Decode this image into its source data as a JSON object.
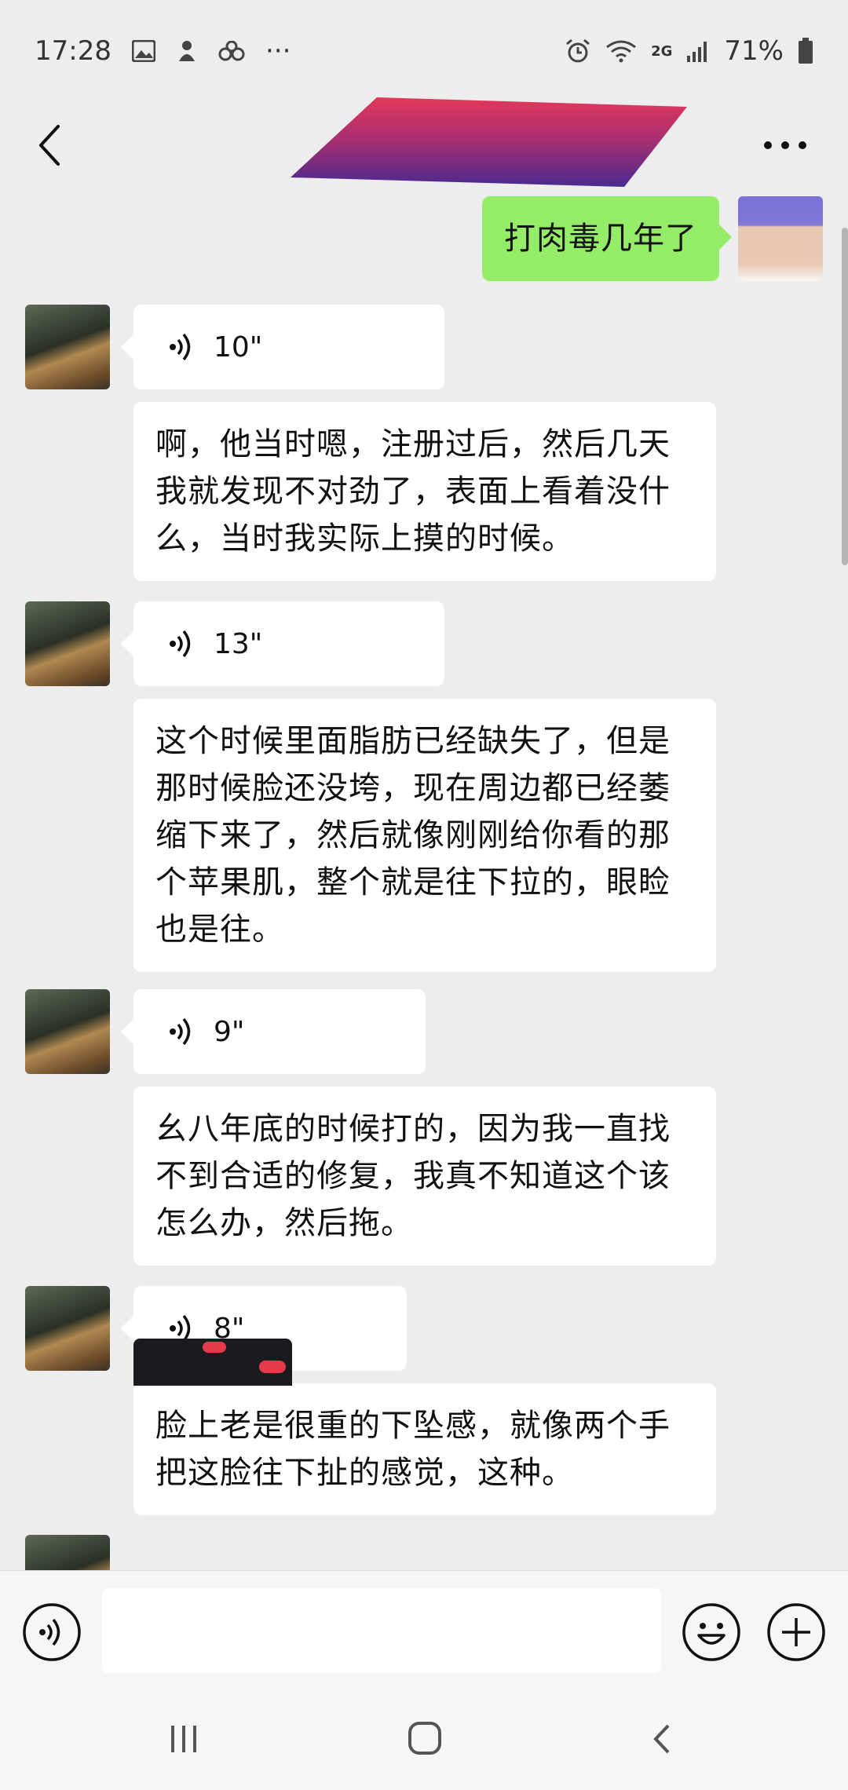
{
  "status": {
    "time": "17:28",
    "more": "···",
    "network": "2G",
    "battery": "71%"
  },
  "header": {
    "title": "",
    "back_icon": "chevron-left-icon",
    "more_icon": "ellipsis-icon"
  },
  "messages": [
    {
      "sender": "me",
      "type": "text",
      "text": "打肉毒几年了"
    },
    {
      "sender": "them",
      "type": "voice",
      "duration": "10\"",
      "transcript": "啊，他当时嗯，注册过后，然后几天我就发现不对劲了，表面上看着没什么，当时我实际上摸的时候。"
    },
    {
      "sender": "them",
      "type": "voice",
      "duration": "13\"",
      "transcript": "这个时候里面脂肪已经缺失了，但是那时候脸还没垮，现在周边都已经萎缩下来了，然后就像刚刚给你看的那个苹果肌，整个就是往下拉的，眼睑也是往。"
    },
    {
      "sender": "them",
      "type": "voice",
      "duration": "9\"",
      "transcript": "幺八年底的时候打的，因为我一直找不到合适的修复，我真不知道这个该怎么办，然后拖。"
    },
    {
      "sender": "them",
      "type": "voice",
      "duration": "8\"",
      "transcript": "脸上老是很重的下坠感，就像两个手把这脸往下扯的感觉，这种。"
    },
    {
      "sender": "them",
      "type": "image"
    }
  ],
  "input": {
    "value": "",
    "placeholder": ""
  },
  "colors": {
    "background": "#ededed",
    "my_bubble": "#95ec69",
    "their_bubble": "#ffffff"
  }
}
